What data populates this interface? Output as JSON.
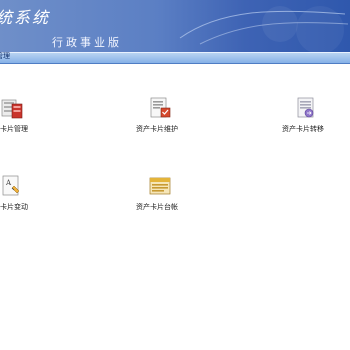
{
  "banner": {
    "title": "统系统",
    "subtitle": "行政事业版"
  },
  "navbar": {
    "label": "管理"
  },
  "cards": [
    {
      "label": "卡片管理",
      "icon": "asset-card-manage-icon"
    },
    {
      "label": "资产卡片维护",
      "icon": "asset-card-maintain-icon"
    },
    {
      "label": "资产卡片转移",
      "icon": "asset-card-transfer-icon"
    },
    {
      "label": "卡片变动",
      "icon": "asset-card-change-icon"
    },
    {
      "label": "资产卡片台帐",
      "icon": "asset-card-ledger-icon"
    }
  ],
  "colors": {
    "banner": "#3e63b4",
    "navbar": "#86b1e8",
    "background": "#ffffff"
  }
}
